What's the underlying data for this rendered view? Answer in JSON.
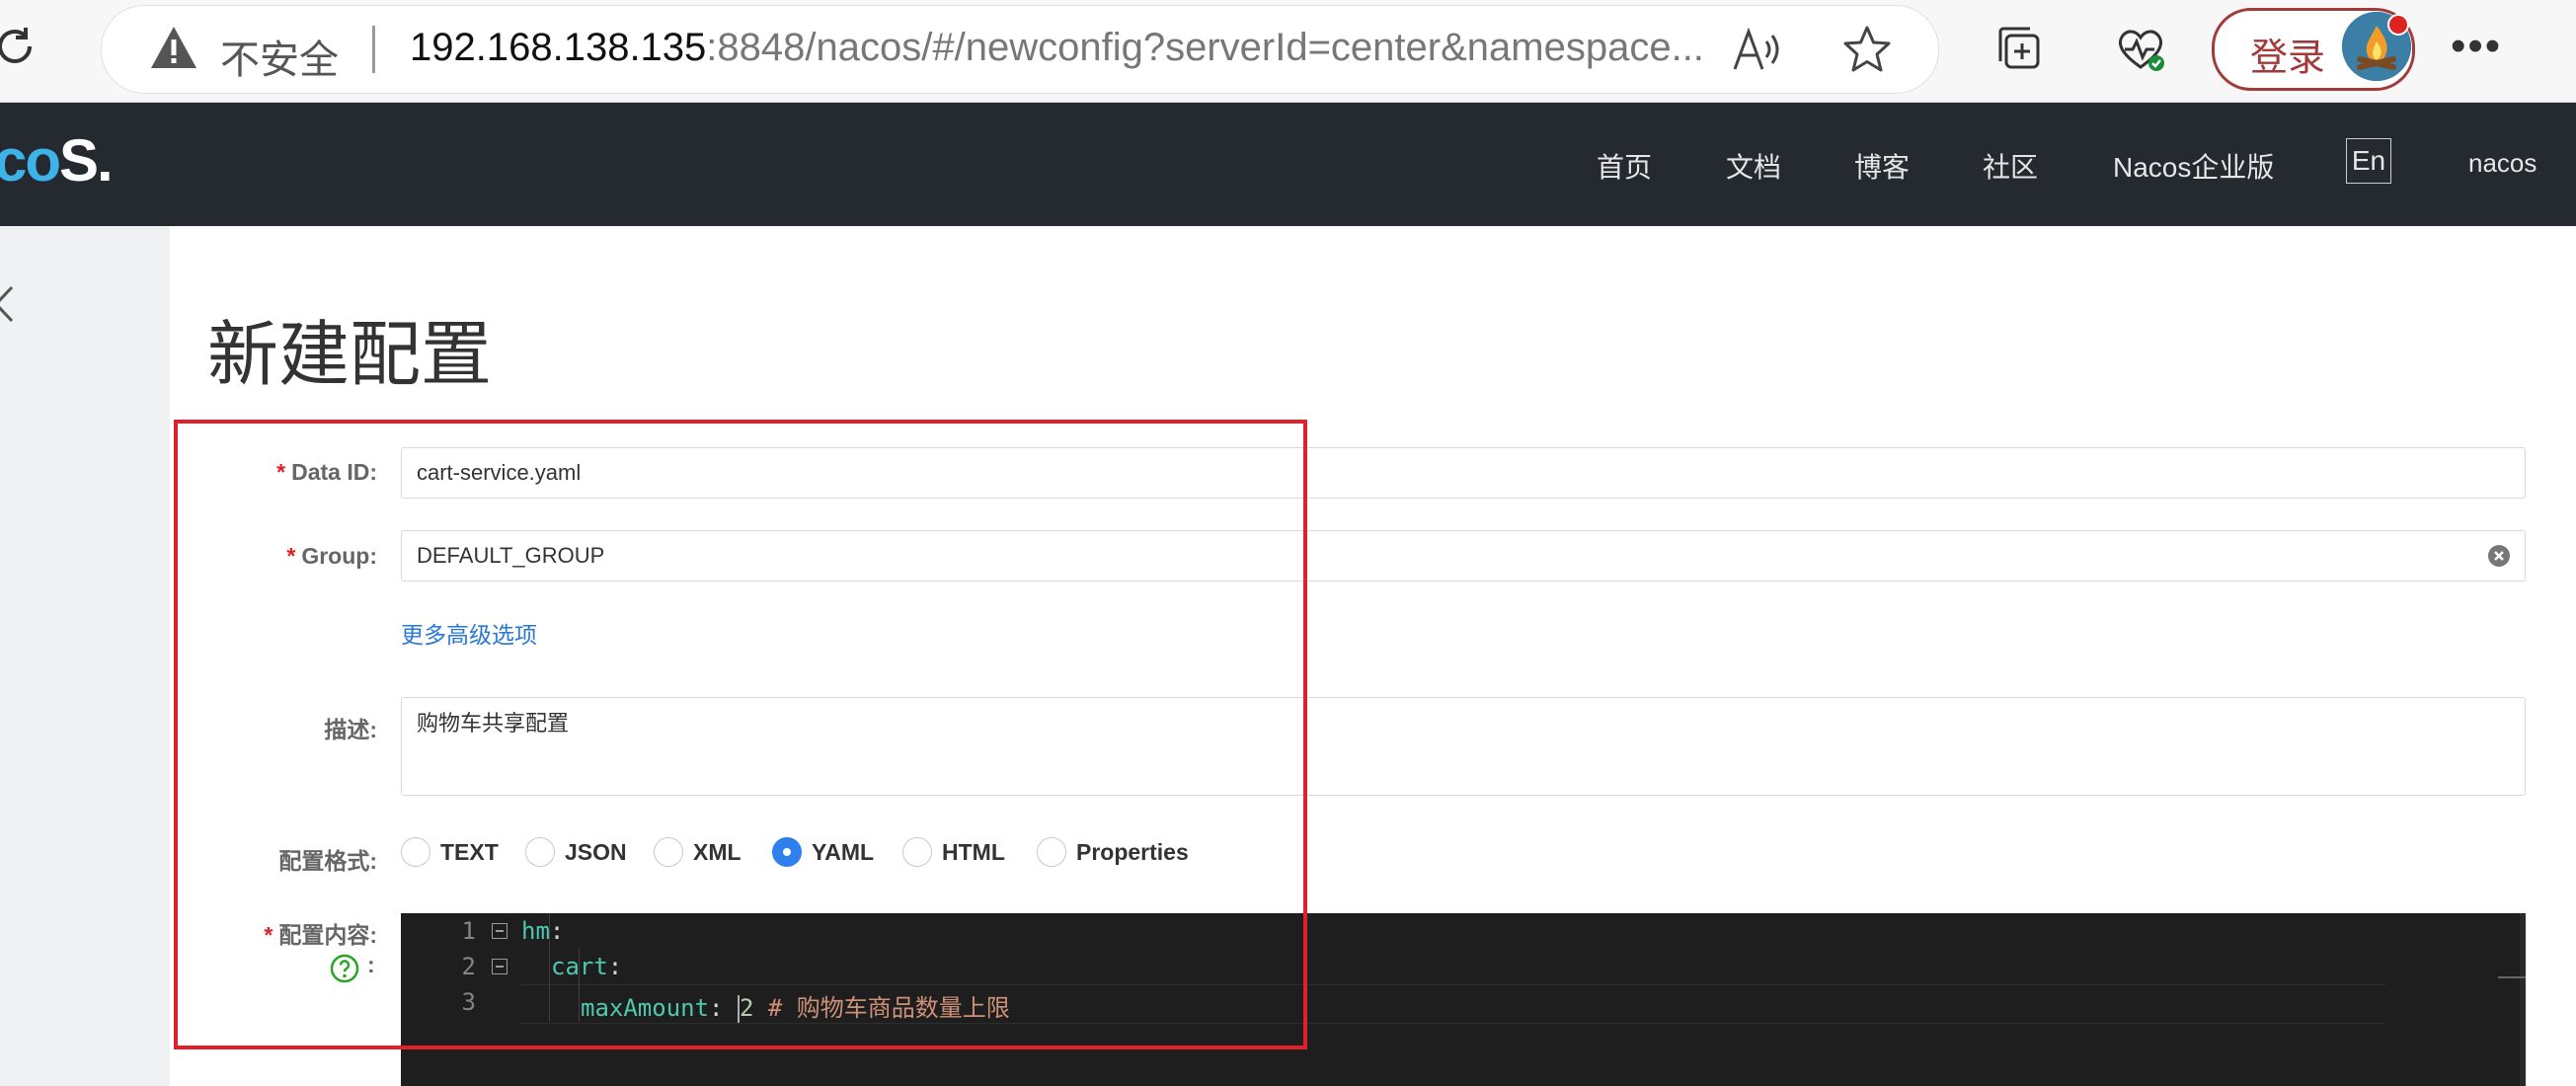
{
  "browser": {
    "security_label": "不安全",
    "url_host": "192.168.138.135",
    "url_rest": ":8848/nacos/#/newconfig?serverId=center&namespace...",
    "login_label": "登录"
  },
  "header": {
    "logo_prefix": "co",
    "logo_suffix": "S.",
    "nav": [
      "首页",
      "文档",
      "博客",
      "社区",
      "Nacos企业版"
    ],
    "language": "En",
    "user": "nacos"
  },
  "page": {
    "title": "新建配置"
  },
  "form": {
    "data_id": {
      "label": "Data ID:",
      "value": "cart-service.yaml"
    },
    "group": {
      "label": "Group:",
      "value": "DEFAULT_GROUP"
    },
    "advanced_link": "更多高级选项",
    "description": {
      "label": "描述:",
      "value": "购物车共享配置"
    },
    "format": {
      "label": "配置格式:",
      "options": [
        "TEXT",
        "JSON",
        "XML",
        "YAML",
        "HTML",
        "Properties"
      ],
      "selected": "YAML"
    },
    "content": {
      "label": "配置内容:",
      "help_suffix": ":"
    }
  },
  "editor": {
    "lines": [
      {
        "number": "1",
        "key": "hm",
        "colon": ":"
      },
      {
        "number": "2",
        "key": "cart",
        "colon": ":"
      },
      {
        "number": "3",
        "key": "maxAmount",
        "colon": ": ",
        "value": "2",
        "comment": " # 购物车商品数量上限"
      }
    ]
  },
  "colors": {
    "header_bg": "#252a30",
    "primary": "#2f80ed",
    "required": "#e02020",
    "annotation_box": "#e0202a",
    "editor_bg": "#1e1e1e"
  }
}
